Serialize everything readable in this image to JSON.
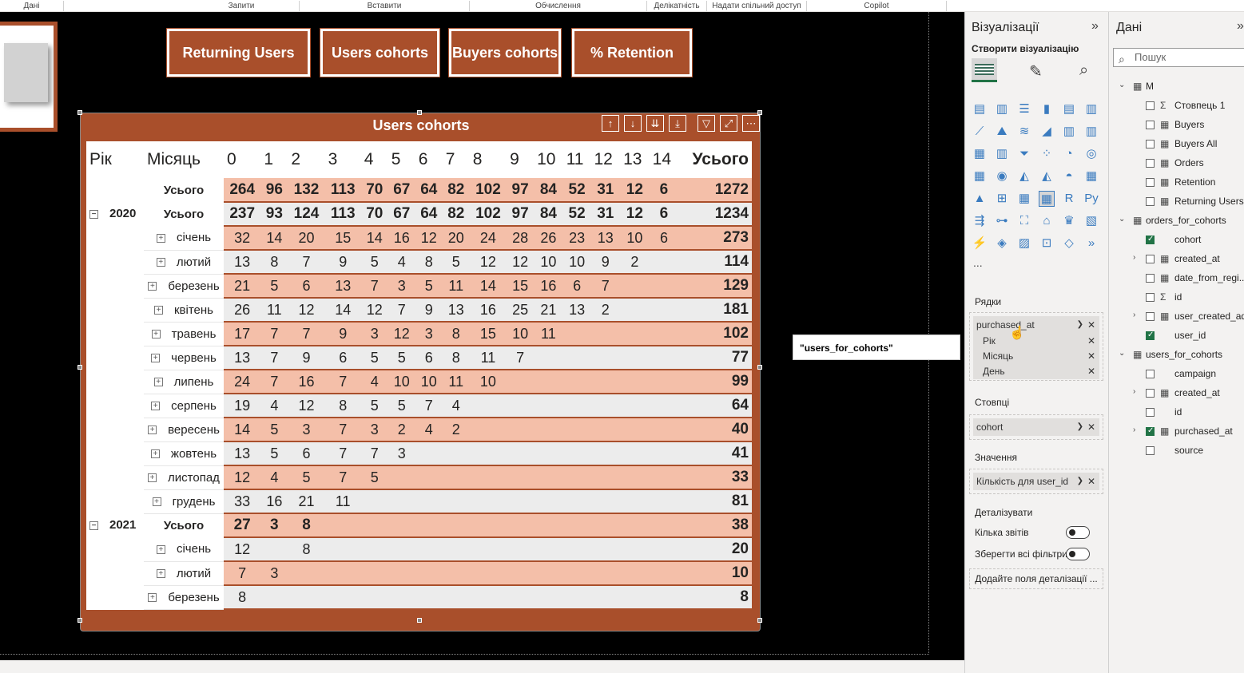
{
  "ribbon": {
    "groups": [
      "Дані",
      "Запити",
      "Вставити",
      "Обчислення",
      "Делікатність",
      "Надати спільний доступ",
      "Copilot"
    ]
  },
  "nav": {
    "btn1": "Returning Users",
    "btn2": "Users cohorts",
    "btn3": "Buyers cohorts",
    "btn4": "% Retention"
  },
  "visual": {
    "title": "Users cohorts",
    "header": {
      "year": "Рік",
      "month": "Місяць",
      "cols": [
        "0",
        "1",
        "2",
        "3",
        "4",
        "5",
        "6",
        "7",
        "8",
        "9",
        "10",
        "11",
        "12",
        "13",
        "14"
      ],
      "total": "Усього"
    },
    "total_label": "Усього",
    "grand_total": {
      "values": [
        "264",
        "96",
        "132",
        "113",
        "70",
        "67",
        "64",
        "82",
        "102",
        "97",
        "84",
        "52",
        "31",
        "12",
        "6"
      ],
      "total": "1272"
    },
    "y2020": {
      "year": "2020",
      "label": "Усього",
      "values": [
        "237",
        "93",
        "124",
        "113",
        "70",
        "67",
        "64",
        "82",
        "102",
        "97",
        "84",
        "52",
        "31",
        "12",
        "6"
      ],
      "total": "1234"
    },
    "m2020": [
      {
        "name": "січень",
        "values": [
          "32",
          "14",
          "20",
          "15",
          "14",
          "16",
          "12",
          "20",
          "24",
          "28",
          "26",
          "23",
          "13",
          "10",
          "6"
        ],
        "total": "273"
      },
      {
        "name": "лютий",
        "values": [
          "13",
          "8",
          "7",
          "9",
          "5",
          "4",
          "8",
          "5",
          "12",
          "12",
          "10",
          "10",
          "9",
          "2",
          ""
        ],
        "total": "114"
      },
      {
        "name": "березень",
        "values": [
          "21",
          "5",
          "6",
          "13",
          "7",
          "3",
          "5",
          "11",
          "14",
          "15",
          "16",
          "6",
          "7",
          "",
          ""
        ],
        "total": "129"
      },
      {
        "name": "квітень",
        "values": [
          "26",
          "11",
          "12",
          "14",
          "12",
          "7",
          "9",
          "13",
          "16",
          "25",
          "21",
          "13",
          "2",
          "",
          ""
        ],
        "total": "181"
      },
      {
        "name": "травень",
        "values": [
          "17",
          "7",
          "7",
          "9",
          "3",
          "12",
          "3",
          "8",
          "15",
          "10",
          "11",
          "",
          "",
          "",
          ""
        ],
        "total": "102"
      },
      {
        "name": "червень",
        "values": [
          "13",
          "7",
          "9",
          "6",
          "5",
          "5",
          "6",
          "8",
          "11",
          "7",
          "",
          "",
          "",
          "",
          ""
        ],
        "total": "77"
      },
      {
        "name": "липень",
        "values": [
          "24",
          "7",
          "16",
          "7",
          "4",
          "10",
          "10",
          "11",
          "10",
          "",
          "",
          "",
          "",
          "",
          ""
        ],
        "total": "99"
      },
      {
        "name": "серпень",
        "values": [
          "19",
          "4",
          "12",
          "8",
          "5",
          "5",
          "7",
          "4",
          "",
          "",
          "",
          "",
          "",
          "",
          ""
        ],
        "total": "64"
      },
      {
        "name": "вересень",
        "values": [
          "14",
          "5",
          "3",
          "7",
          "3",
          "2",
          "4",
          "2",
          "",
          "",
          "",
          "",
          "",
          "",
          ""
        ],
        "total": "40"
      },
      {
        "name": "жовтень",
        "values": [
          "13",
          "5",
          "6",
          "7",
          "7",
          "3",
          "",
          "",
          "",
          "",
          "",
          "",
          "",
          "",
          ""
        ],
        "total": "41"
      },
      {
        "name": "листопад",
        "values": [
          "12",
          "4",
          "5",
          "7",
          "5",
          "",
          "",
          "",
          "",
          "",
          "",
          "",
          "",
          "",
          ""
        ],
        "total": "33"
      },
      {
        "name": "грудень",
        "values": [
          "33",
          "16",
          "21",
          "11",
          "",
          "",
          "",
          "",
          "",
          "",
          "",
          "",
          "",
          "",
          ""
        ],
        "total": "81"
      }
    ],
    "y2021": {
      "year": "2021",
      "label": "Усього",
      "values": [
        "27",
        "3",
        "8",
        "",
        "",
        "",
        "",
        "",
        "",
        "",
        "",
        "",
        "",
        "",
        ""
      ],
      "total": "38"
    },
    "m2021": [
      {
        "name": "січень",
        "values": [
          "12",
          "",
          "8",
          "",
          "",
          "",
          "",
          "",
          "",
          "",
          "",
          "",
          "",
          "",
          ""
        ],
        "total": "20"
      },
      {
        "name": "лютий",
        "values": [
          "7",
          "3",
          "",
          "",
          "",
          "",
          "",
          "",
          "",
          "",
          "",
          "",
          "",
          "",
          ""
        ],
        "total": "10"
      },
      {
        "name": "березень",
        "values": [
          "8",
          "",
          "",
          "",
          "",
          "",
          "",
          "",
          "",
          "",
          "",
          "",
          "",
          "",
          ""
        ],
        "total": "8"
      }
    ]
  },
  "tooltip": "\"users_for_cohorts\"[purchased_at]",
  "viz_panel": {
    "title": "Візуалізації",
    "build": "Створити візуалізацію",
    "rows_label": "Рядки",
    "rows_field": "purchased_at",
    "rows_sub": [
      "Рік",
      "Місяць",
      "День"
    ],
    "cols_label": "Стовпці",
    "cols_field": "cohort",
    "values_label": "Значення",
    "values_field": "Кількість для user_id",
    "drill_label": "Деталізувати",
    "cross_report": "Кілька звітів",
    "keep_filters": "Зберегти всі фільтри",
    "add_drill": "Додайте поля деталізації ...",
    "more": "..."
  },
  "data_panel": {
    "title": "Дані",
    "search_placeholder": "Пошук",
    "items": [
      {
        "label": "M",
        "type": "table",
        "checked": false
      },
      {
        "label": "Стовпець 1",
        "type": "sigma",
        "checked": false
      },
      {
        "label": "Buyers",
        "type": "measure",
        "checked": false
      },
      {
        "label": "Buyers All",
        "type": "measure",
        "checked": false
      },
      {
        "label": "Orders",
        "type": "measure",
        "checked": false
      },
      {
        "label": "Retention",
        "type": "measure",
        "checked": false
      },
      {
        "label": "Returning Users",
        "type": "measure",
        "checked": false
      },
      {
        "label": "orders_for_cohorts",
        "type": "table",
        "checked": false
      },
      {
        "label": "cohort",
        "type": "field",
        "checked": true
      },
      {
        "label": "created_at",
        "type": "date",
        "checked": false
      },
      {
        "label": "date_from_regi...",
        "type": "calc",
        "checked": false
      },
      {
        "label": "id",
        "type": "sigma",
        "checked": false
      },
      {
        "label": "user_created_ad",
        "type": "date",
        "checked": false
      },
      {
        "label": "user_id",
        "type": "field",
        "checked": true
      },
      {
        "label": "users_for_cohorts",
        "type": "table",
        "checked": false
      },
      {
        "label": "campaign",
        "type": "field",
        "checked": false
      },
      {
        "label": "created_at",
        "type": "date",
        "checked": false
      },
      {
        "label": "id",
        "type": "field",
        "checked": false
      },
      {
        "label": "purchased_at",
        "type": "date",
        "checked": true
      },
      {
        "label": "source",
        "type": "field",
        "checked": false
      }
    ]
  }
}
